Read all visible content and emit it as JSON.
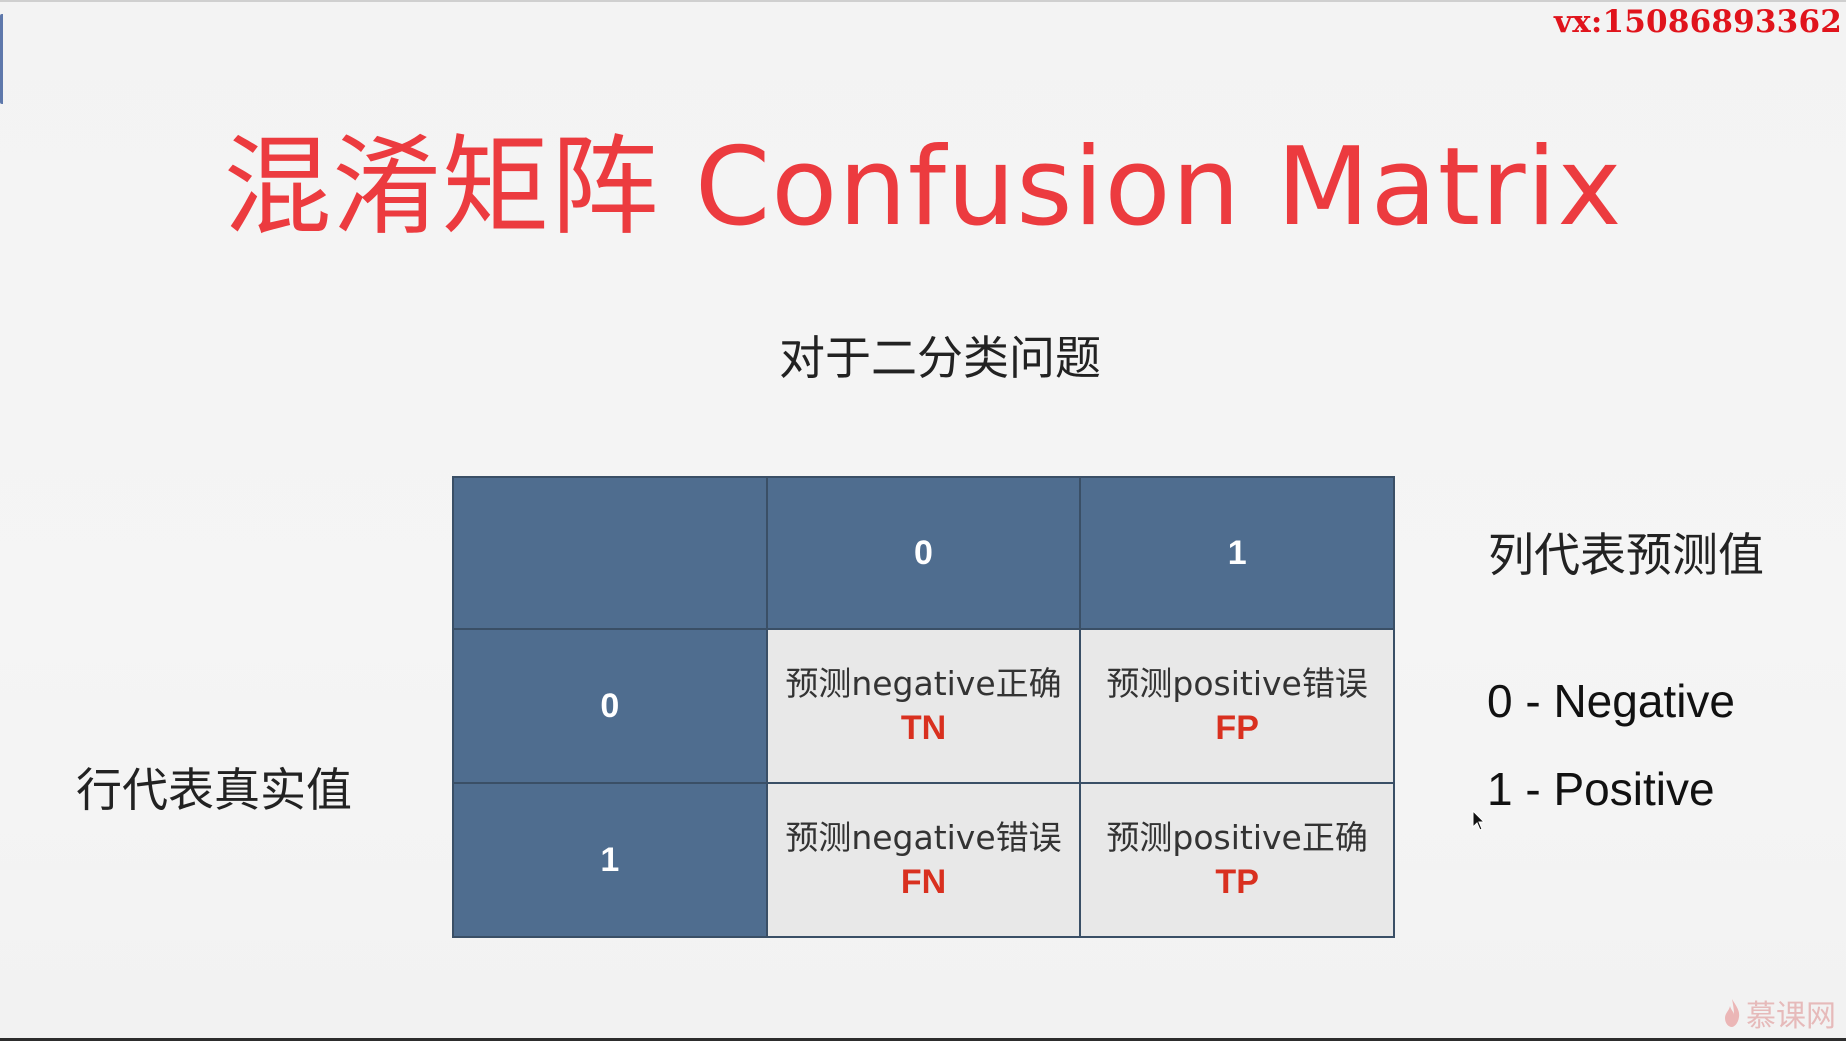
{
  "watermark": "vx:15086893362",
  "title": "混淆矩阵 Confusion Matrix",
  "subtitle": "对于二分类问题",
  "row_axis_label": "行代表真实值",
  "col_axis_label": "列代表预测值",
  "legend": [
    "0 - Negative",
    "1 - Positive"
  ],
  "matrix": {
    "corner": "",
    "col_headers": [
      "0",
      "1"
    ],
    "rows": [
      {
        "header": "0",
        "cells": [
          {
            "desc": "预测negative正确",
            "abbr": "TN"
          },
          {
            "desc": "预测positive错误",
            "abbr": "FP"
          }
        ]
      },
      {
        "header": "1",
        "cells": [
          {
            "desc": "预测negative错误",
            "abbr": "FN"
          },
          {
            "desc": "预测positive正确",
            "abbr": "TP"
          }
        ]
      }
    ]
  },
  "logo_text": "慕课网",
  "colors": {
    "title": "#ec3b3f",
    "header_fill": "#4f6d8f",
    "cell_fill": "#e8e8e8",
    "abbr": "#d9301f",
    "watermark": "#e0141c"
  }
}
